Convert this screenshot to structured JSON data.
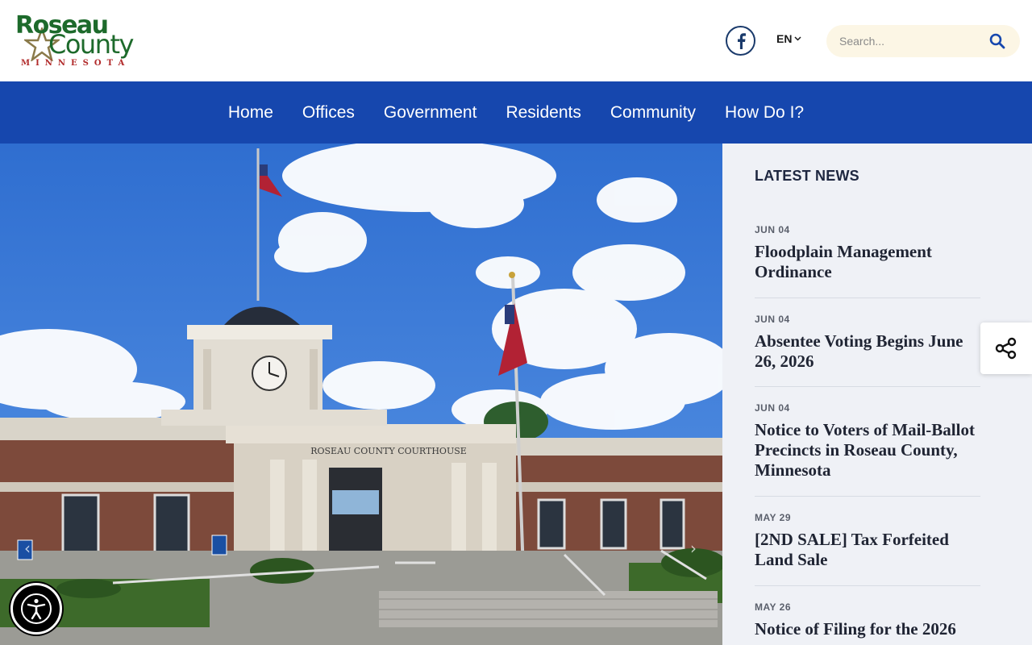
{
  "header": {
    "logo": {
      "line1": "Roseau",
      "line2": "County",
      "line3": "MINNESOTA"
    },
    "language": "EN",
    "search_placeholder": "Search..."
  },
  "nav": {
    "items": [
      "Home",
      "Offices",
      "Government",
      "Residents",
      "Community",
      "How Do I?"
    ]
  },
  "hero": {
    "sign_text": "ROSEAU COUNTY COURTHOUSE"
  },
  "news": {
    "heading": "LATEST NEWS",
    "items": [
      {
        "date": "JUN 04",
        "title": "Floodplain Management Ordinance"
      },
      {
        "date": "JUN 04",
        "title": "Absentee Voting Begins June 26, 2026"
      },
      {
        "date": "JUN 04",
        "title": "Notice to Voters of Mail-Ballot Precincts in Roseau County, Minnesota"
      },
      {
        "date": "MAY 29",
        "title": "[2ND SALE] Tax Forfeited Land Sale"
      },
      {
        "date": "MAY 26",
        "title": "Notice of Filing for the 2026"
      }
    ]
  },
  "colors": {
    "nav_bg": "#1647ae",
    "logo_green": "#1d6a2b",
    "logo_red": "#b12a2a",
    "news_bg": "#eff1f6",
    "search_bg": "#fcf6e5"
  },
  "icons": [
    "facebook-icon",
    "chevron-down-icon",
    "search-icon",
    "share-icon",
    "accessibility-icon",
    "prev-arrow-icon",
    "next-arrow-icon"
  ]
}
